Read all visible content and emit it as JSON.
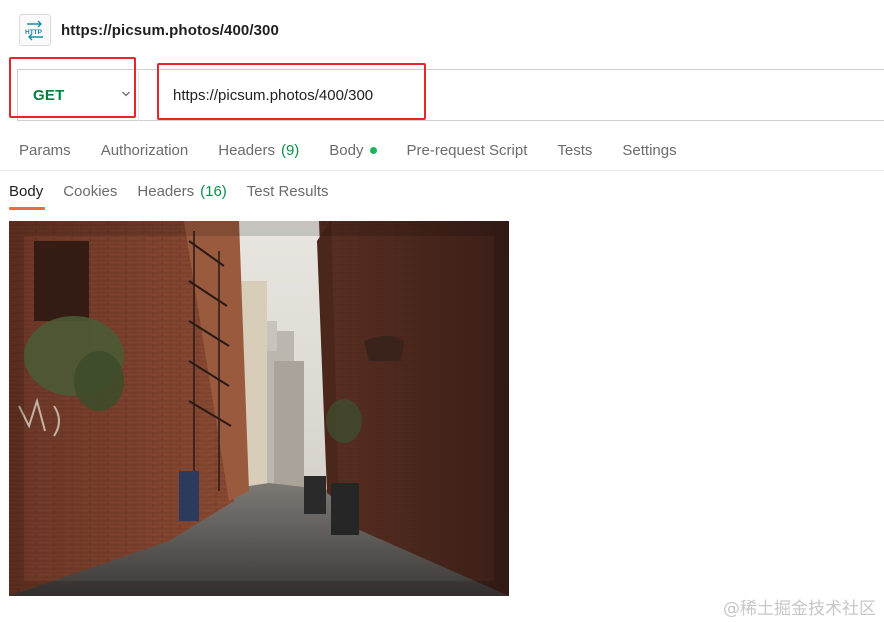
{
  "request": {
    "icon": "http-request-icon",
    "title": "https://picsum.photos/400/300",
    "method": "GET",
    "url": "https://picsum.photos/400/300"
  },
  "request_tabs": [
    {
      "label": "Params"
    },
    {
      "label": "Authorization"
    },
    {
      "label": "Headers",
      "count": "(9)"
    },
    {
      "label": "Body",
      "indicator": "green-dot"
    },
    {
      "label": "Pre-request Script"
    },
    {
      "label": "Tests"
    },
    {
      "label": "Settings"
    }
  ],
  "response_tabs": [
    {
      "label": "Body",
      "active": true
    },
    {
      "label": "Cookies"
    },
    {
      "label": "Headers",
      "count": "(16)"
    },
    {
      "label": "Test Results"
    }
  ],
  "response_body": {
    "type": "image"
  },
  "watermark": "@稀土掘金技术社区",
  "colors": {
    "method_get": "#0a7d3b",
    "count_green": "#0a8f4b",
    "active_tab_accent": "#ef6b3a",
    "annotation_red": "#e8262a"
  }
}
